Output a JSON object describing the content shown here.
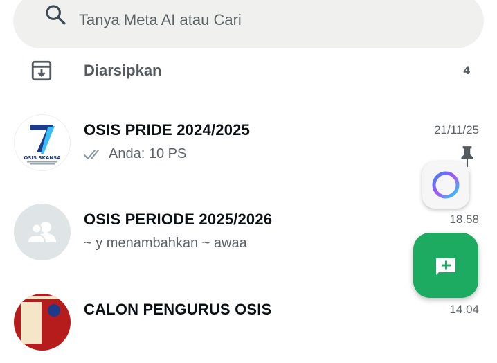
{
  "search": {
    "placeholder": "Tanya Meta AI atau Cari"
  },
  "archived": {
    "label": "Diarsipkan",
    "count": "4"
  },
  "chats": [
    {
      "title": "OSIS PRIDE 2024/2025",
      "time": "21/11/25",
      "preview": "Anda: 10 PS",
      "pinned": true,
      "avatar_text": "OSIS SKANSA"
    },
    {
      "title": "OSIS PERIODE 2025/2026",
      "time": "18.58",
      "preview": "~ y menambahkan ~ awaa"
    },
    {
      "title": "CALON PENGURUS OSIS",
      "time": "14.04"
    }
  ],
  "colors": {
    "accent_green": "#1daa61",
    "ticks_gray": "#8696a0",
    "search_bg": "#f0f0ee"
  },
  "icons": {
    "search": "search-icon",
    "archive": "archive-icon",
    "read_ticks": "double-check-icon",
    "pin": "pin-icon",
    "group_avatar": "group-icon",
    "meta_ai": "meta-ai-icon",
    "new_chat": "new-chat-icon"
  }
}
